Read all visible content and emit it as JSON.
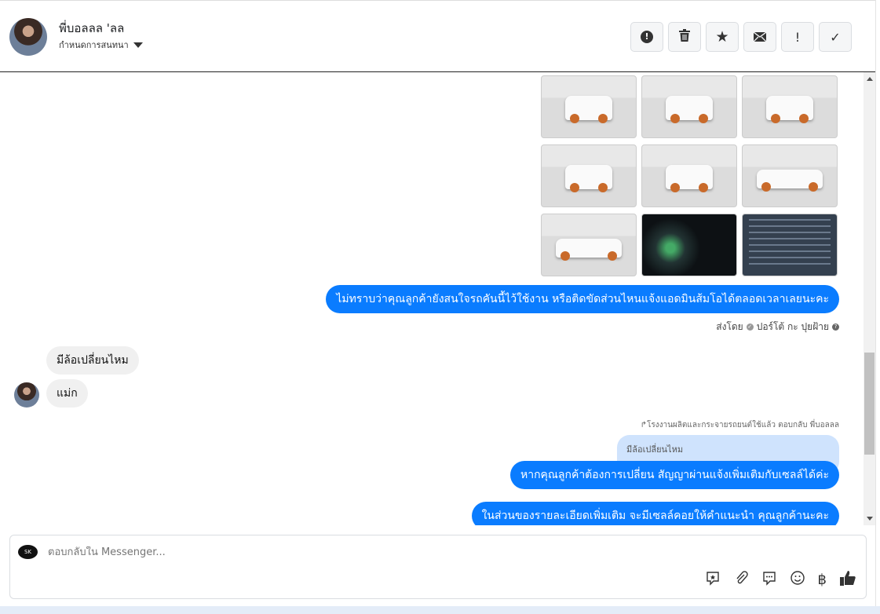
{
  "header": {
    "name": "พี่บอลลล 'ลล",
    "subtitle": "กำหนดการสนทนา"
  },
  "toolbar": [
    {
      "name": "spam",
      "glyph": "●"
    },
    {
      "name": "trash",
      "glyph": "🗑"
    },
    {
      "name": "star",
      "glyph": "★"
    },
    {
      "name": "mail",
      "glyph": "✉"
    },
    {
      "name": "important",
      "glyph": "!"
    },
    {
      "name": "done",
      "glyph": "✓"
    }
  ],
  "messages": {
    "m1": "ไม่ทราบว่าคุณลูกค้ายังสนใจรถคันนี้ไว้ใช้งาน หรือติดขัดส่วนไหนแจ้งแอดมินส้มโอได้ตลอดเวลาเลยนะคะ",
    "sent_by_label": "ส่งโดย",
    "sent_by_name": "ปอร์โต้ กะ ปุยฝ้าย",
    "r1": "มีล้อเปลี่ยนไหม",
    "r2": "แม่ก",
    "reply_note": "↱โรงงานผลิตและกระจายรถยนต์ใช้แล้ว ตอบกลับ พี่บอลลล",
    "quoted": "มีล้อเปลี่ยนไหม",
    "m2": "หากคุณลูกค้าต้องการเปลี่ยน สัญญาผ่านแจ้งเพิ่มเติมกับเซลล์ได้ค่ะ",
    "m3": "ในส่วนของรายละเอียดเพิ่มเติม จะมีเซลล์คอยให้คำแนะนำ คุณลูกค้านะคะ"
  },
  "composer": {
    "placeholder": "ตอบกลับใน Messenger...",
    "logo": "SK",
    "currency": "฿"
  }
}
